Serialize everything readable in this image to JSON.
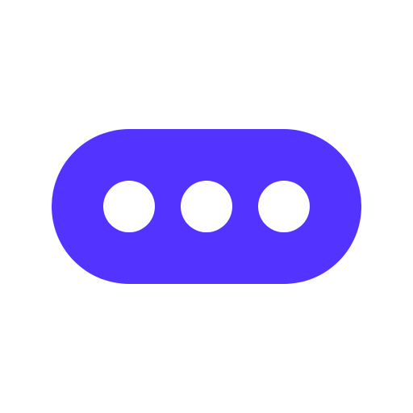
{
  "icon": {
    "name": "more-horizontal-icon",
    "colors": {
      "background": "#ffffff",
      "pill": "#5233FF",
      "dots": "#ffffff"
    },
    "dots": [
      "dot-1",
      "dot-2",
      "dot-3"
    ]
  }
}
